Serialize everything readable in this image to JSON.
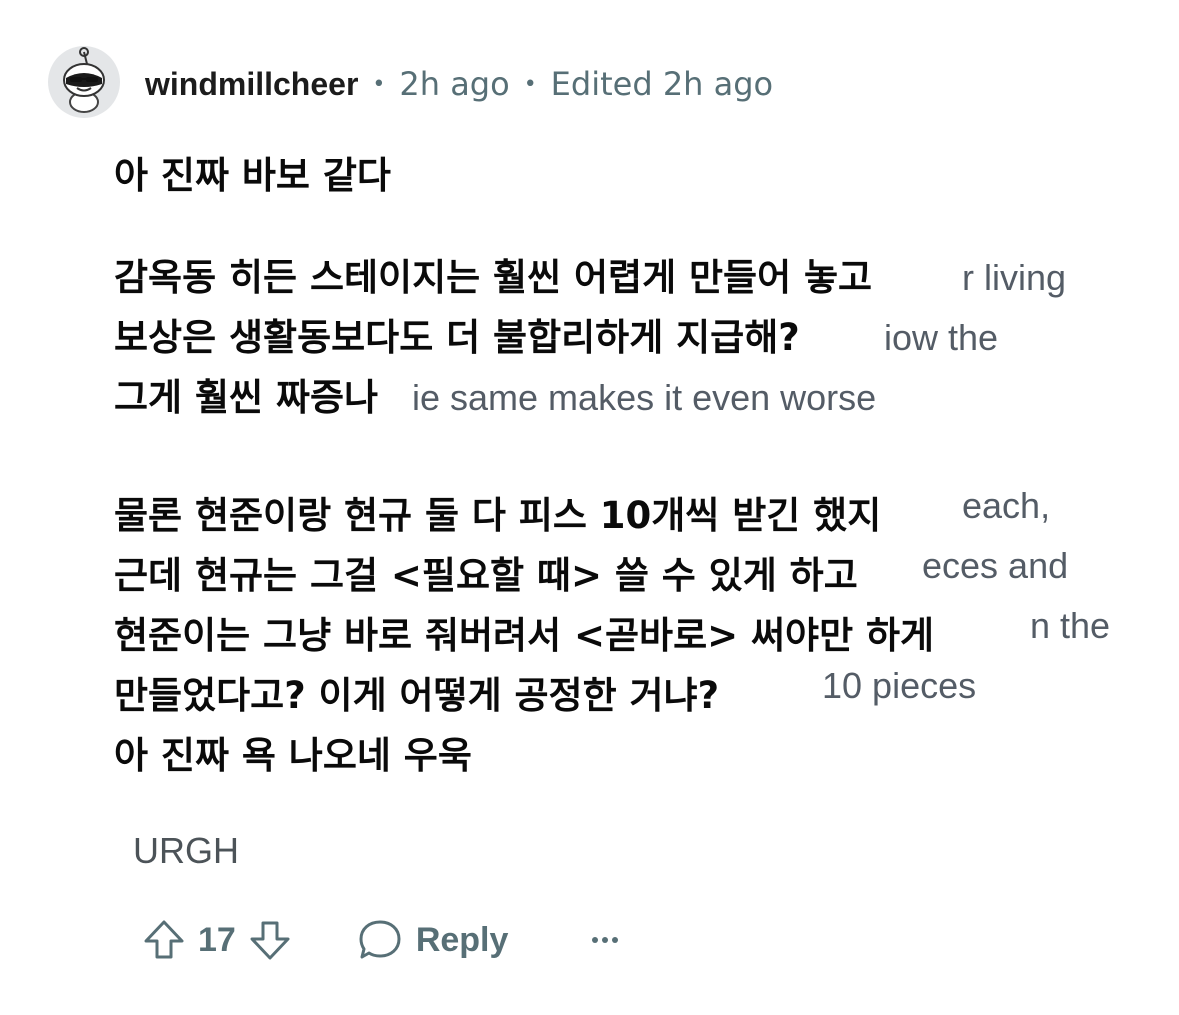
{
  "comment": {
    "author": "windmillcheer",
    "posted": "2h ago",
    "edited": "Edited 2h ago"
  },
  "overlay_text": {
    "korean_lines": [
      "아 진짜 바보 같다",
      "감옥동 히든 스테이지는 훨씬 어렵게 만들어 놓고",
      "보상은 생활동보다도 더 불합리하게 지급해?",
      "그게 훨씬 짜증나",
      "물론 현준이랑 현규 둘 다 피스 10개씩 받긴 했지",
      "근데 현규는 그걸 <필요할 때> 쓸 수 있게 하고",
      "현준이는 그냥 바로 줘버려서 <곧바로> 써야만 하게",
      "만들었다고? 이게 어떻게 공정한 거냐?",
      "아 진짜 욕 나오네 우욱"
    ],
    "background_fragments": [
      "r living",
      "iow the",
      "ie same makes it even worse",
      "each,",
      "eces and",
      "n the",
      "10 pieces"
    ]
  },
  "last_line": "URGH",
  "actions": {
    "vote_count": "17",
    "reply_label": "Reply"
  },
  "icons": {
    "avatar": "snoo-avatar-sunglasses",
    "upvote": "arrow-up-icon",
    "downvote": "arrow-down-icon",
    "reply": "speech-bubble-icon",
    "more": "ellipsis-icon"
  },
  "colors": {
    "meta_text": "#576f76",
    "username": "#1c1c1c",
    "korean_text": "#0a0a0a"
  }
}
